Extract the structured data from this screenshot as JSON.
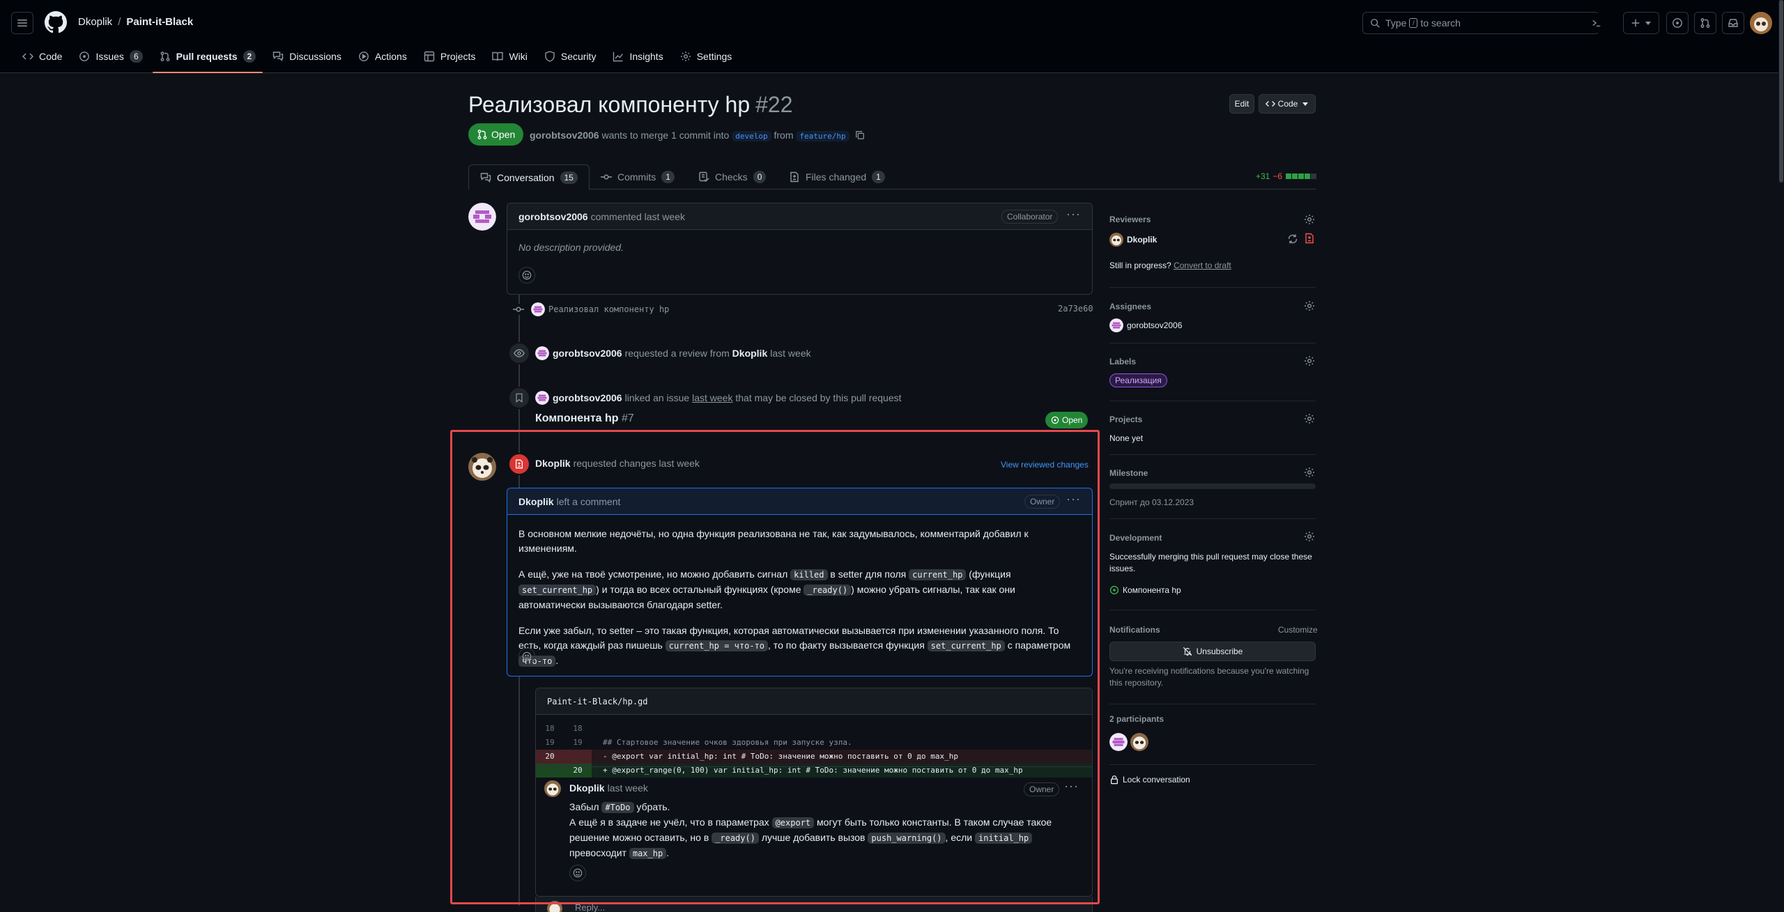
{
  "header": {
    "owner": "Dkoplik",
    "separator": "/",
    "repo": "Paint-it-Black",
    "search": {
      "prefix": "Type",
      "key": "/",
      "suffix": "to search"
    }
  },
  "repo_nav": [
    {
      "label": "Code",
      "count": ""
    },
    {
      "label": "Issues",
      "count": "6"
    },
    {
      "label": "Pull requests",
      "count": "2"
    },
    {
      "label": "Discussions",
      "count": ""
    },
    {
      "label": "Actions",
      "count": ""
    },
    {
      "label": "Projects",
      "count": ""
    },
    {
      "label": "Wiki",
      "count": ""
    },
    {
      "label": "Security",
      "count": ""
    },
    {
      "label": "Insights",
      "count": ""
    },
    {
      "label": "Settings",
      "count": ""
    }
  ],
  "pr": {
    "title": "Реализовал компоненту hp",
    "number": "#22",
    "edit_label": "Edit",
    "code_label": "Code",
    "state": "Open",
    "author": "gorobtsov2006",
    "merge_text": "wants to merge 1 commit into",
    "base": "develop",
    "from_text": "from",
    "head": "feature/hp"
  },
  "tabs": [
    {
      "label": "Conversation",
      "count": "15"
    },
    {
      "label": "Commits",
      "count": "1"
    },
    {
      "label": "Checks",
      "count": "0"
    },
    {
      "label": "Files changed",
      "count": "1"
    }
  ],
  "diffstat": {
    "add": "+31",
    "del": "−6",
    "add_blocks": 4,
    "total_blocks": 5
  },
  "first_comment": {
    "author": "gorobtsov2006",
    "action": "commented last week",
    "role": "Collaborator",
    "body": "No description provided."
  },
  "commit": {
    "message": "Реализовал компоненту hp",
    "sha": "2a73e60"
  },
  "event_review": {
    "actor": "gorobtsov2006",
    "text": "requested a review from",
    "target": "Dkoplik",
    "time": "last week"
  },
  "event_link": {
    "actor": "gorobtsov2006",
    "text1": "linked an issue",
    "time": "last week",
    "text2": "that may be closed by this pull request"
  },
  "linked_issue": {
    "title": "Компонента hp",
    "number": "#7",
    "state": "Open"
  },
  "review": {
    "author": "Dkoplik",
    "action": "requested changes last week",
    "view_link": "View reviewed changes",
    "comment_author": "Dkoplik",
    "comment_action": "left a comment",
    "role": "Owner",
    "p1": "В основном мелкие недочёты, но одна функция реализована не так, как задумывалось, комментарий добавил к изменениям.",
    "p2_a": "А ещё, уже на твоё усмотрение, но можно добавить сигнал",
    "p2_code1": "killed",
    "p2_b": "в setter для поля",
    "p2_code2": "current_hp",
    "p2_c": "(функция",
    "p2_code3": "set_current_hp",
    "p2_d": ") и тогда во всех остальный функциях (кроме",
    "p2_code4": "_ready()",
    "p2_e": ") можно убрать сигналы, так как они автоматически вызываются благодаря setter.",
    "p3_a": "Если уже забыл, то setter – это такая функция, которая автоматически вызывается при изменении указанного поля. То есть, когда каждый раз пишешь",
    "p3_code1": "current_hp = что-то",
    "p3_b": ", то по факту вызывается функция",
    "p3_code2": "set_current_hp",
    "p3_c": "с параметром",
    "p3_code3": "что-то",
    "p3_d": "."
  },
  "diff": {
    "file": "Paint-it-Black/hp.gd",
    "lines": [
      {
        "old": "18",
        "new": "18",
        "type": "ctx",
        "code": ""
      },
      {
        "old": "19",
        "new": "19",
        "type": "ctx",
        "code": "## Стартовое значение очков здоровья при запуске узла."
      },
      {
        "old": "20",
        "new": "",
        "type": "del",
        "code": "- @export var initial_hp: int # ToDo: значение можно поставить от 0 до max_hp"
      },
      {
        "old": "",
        "new": "20",
        "type": "add",
        "code": "+ @export_range(0, 100) var initial_hp: int # ToDo: значение можно поставить от 0 до max_hp"
      }
    ]
  },
  "inline_comment": {
    "author": "Dkoplik",
    "time": "last week",
    "role": "Owner",
    "l1_a": "Забыл",
    "l1_code": "#ToDo",
    "l1_b": "убрать.",
    "l2_a": "А ещё я в задаче не учёл, что в параметрах",
    "l2_code1": "@export",
    "l2_b": "могут быть только константы. В таком случае такое решение можно оставить, но в",
    "l2_code2": "_ready()",
    "l2_c": "лучше добавить вызов",
    "l2_code3": "push_warning()",
    "l2_d": ", если",
    "l2_code4": "initial_hp",
    "l2_e": "превосходит",
    "l2_code5": "max_hp",
    "l2_f": "."
  },
  "reply_placeholder": "Reply...",
  "sidebar": {
    "reviewers_h": "Reviewers",
    "reviewer": "Dkoplik",
    "still_progress": "Still in progress?",
    "convert_draft": "Convert to draft",
    "assignees_h": "Assignees",
    "assignee": "gorobtsov2006",
    "labels_h": "Labels",
    "label": "Реализация",
    "projects_h": "Projects",
    "projects_val": "None yet",
    "milestone_h": "Milestone",
    "milestone_val": "Спринт до 03.12.2023",
    "development_h": "Development",
    "development_text": "Successfully merging this pull request may close these issues.",
    "development_issue": "Компонента hp",
    "notifications_h": "Notifications",
    "customize": "Customize",
    "unsubscribe": "Unsubscribe",
    "notif_reason": "You're receiving notifications because you're watching this repository.",
    "participants_h": "2 participants",
    "lock": "Lock conversation"
  },
  "colors": {
    "accent_open": "#238636",
    "tab_underline": "#fd8c73",
    "highlight_box": "#e5484d",
    "label": "#d2a8ff"
  }
}
